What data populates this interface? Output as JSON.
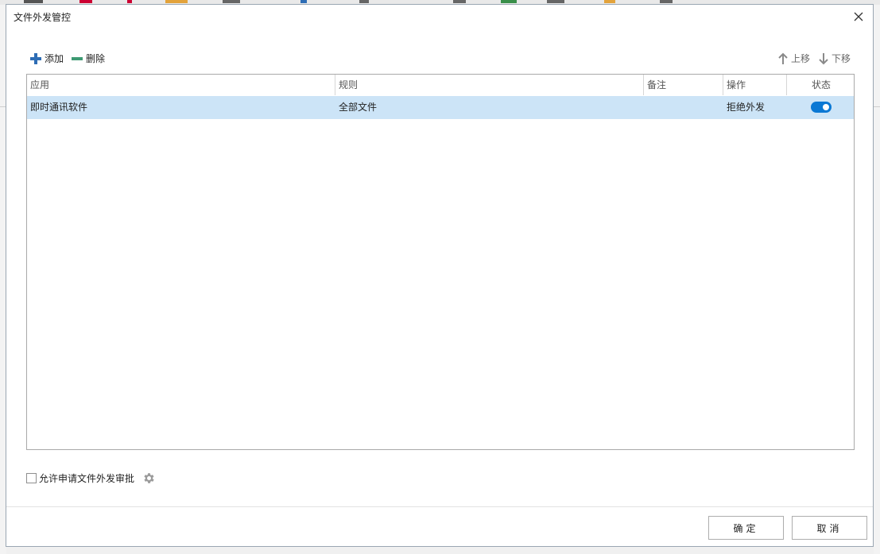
{
  "dialog": {
    "title": "文件外发管控",
    "toolbar": {
      "add_label": "添加",
      "delete_label": "删除",
      "move_up_label": "上移",
      "move_down_label": "下移"
    },
    "table": {
      "columns": [
        "应用",
        "规则",
        "备注",
        "操作",
        "状态"
      ],
      "rows": [
        {
          "app": "即时通讯软件",
          "rule": "全部文件",
          "note": "",
          "action": "拒绝外发",
          "status_on": true
        }
      ]
    },
    "approval_checkbox_label": "允许申请文件外发审批",
    "approval_checked": false,
    "ok_label": "确定",
    "cancel_label": "取消"
  },
  "colors": {
    "selection": "#cce4f7",
    "toggle_on": "#0a78d4",
    "add_icon": "#2e6db5",
    "delete_icon": "#3e9a73"
  },
  "icons": {
    "close": "close-icon",
    "add": "plus-icon",
    "delete": "minus-icon",
    "up": "arrow-up-icon",
    "down": "arrow-down-icon",
    "settings": "gear-icon"
  }
}
